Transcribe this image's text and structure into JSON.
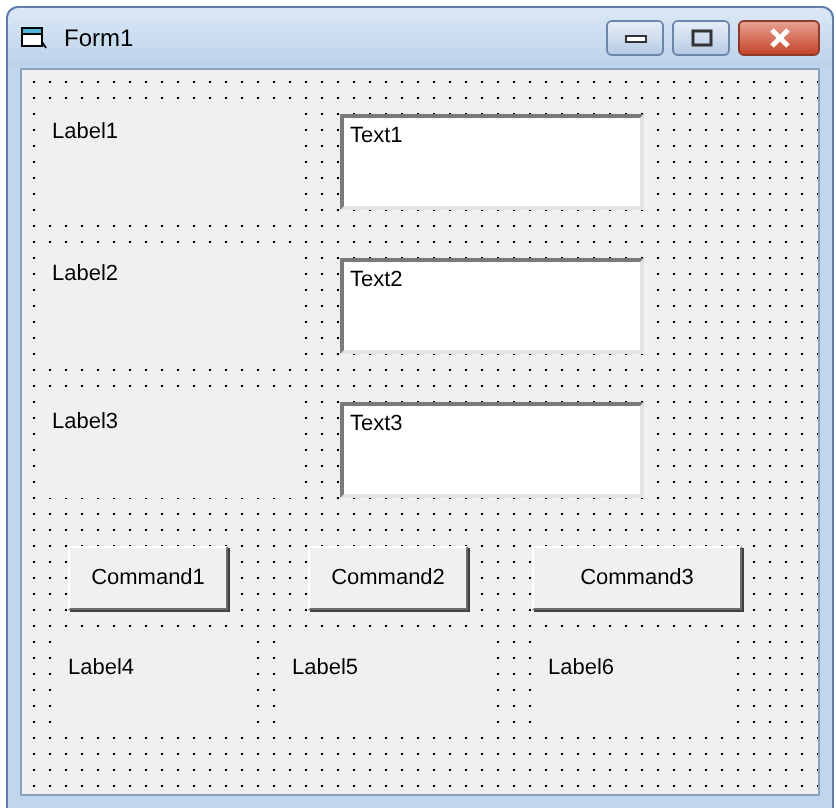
{
  "window": {
    "title": "Form1"
  },
  "controls": [
    {
      "kind": "label",
      "text": "Label1"
    },
    {
      "kind": "textbox",
      "text": "Text1"
    },
    {
      "kind": "label",
      "text": "Label2"
    },
    {
      "kind": "textbox",
      "text": "Text2"
    },
    {
      "kind": "label",
      "text": "Label3"
    },
    {
      "kind": "textbox",
      "text": "Text3"
    },
    {
      "kind": "button",
      "text": "Command1"
    },
    {
      "kind": "button",
      "text": "Command2"
    },
    {
      "kind": "button",
      "text": "Command3"
    },
    {
      "kind": "label",
      "text": "Label4"
    },
    {
      "kind": "label",
      "text": "Label5"
    },
    {
      "kind": "label",
      "text": "Label6"
    }
  ]
}
